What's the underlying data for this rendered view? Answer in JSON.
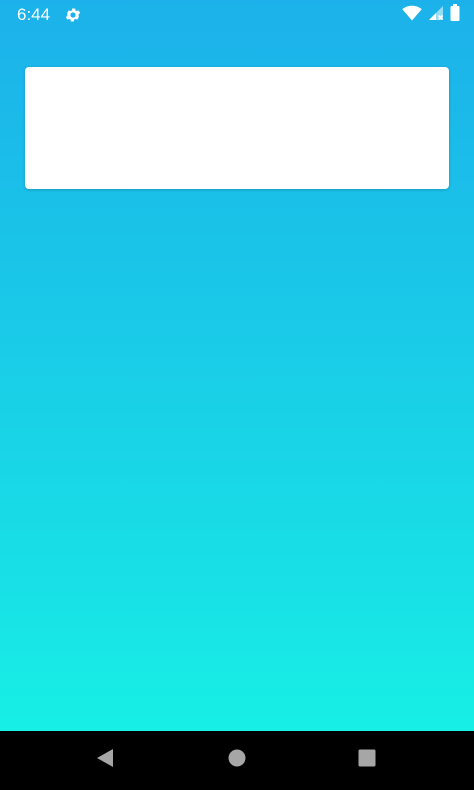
{
  "status_bar": {
    "time": "6:44",
    "icons": [
      "settings-gear-icon",
      "wifi-icon",
      "cell-signal-no-service-icon",
      "battery-icon"
    ]
  },
  "background": {
    "gradient_top": "#1cb1ea",
    "gradient_bottom": "#17efe5"
  },
  "card": {
    "color": "#ffffff"
  },
  "nav_bar": {
    "buttons": [
      "back-icon",
      "home-icon",
      "recents-icon"
    ],
    "icon_color": "#9e9e9e"
  }
}
